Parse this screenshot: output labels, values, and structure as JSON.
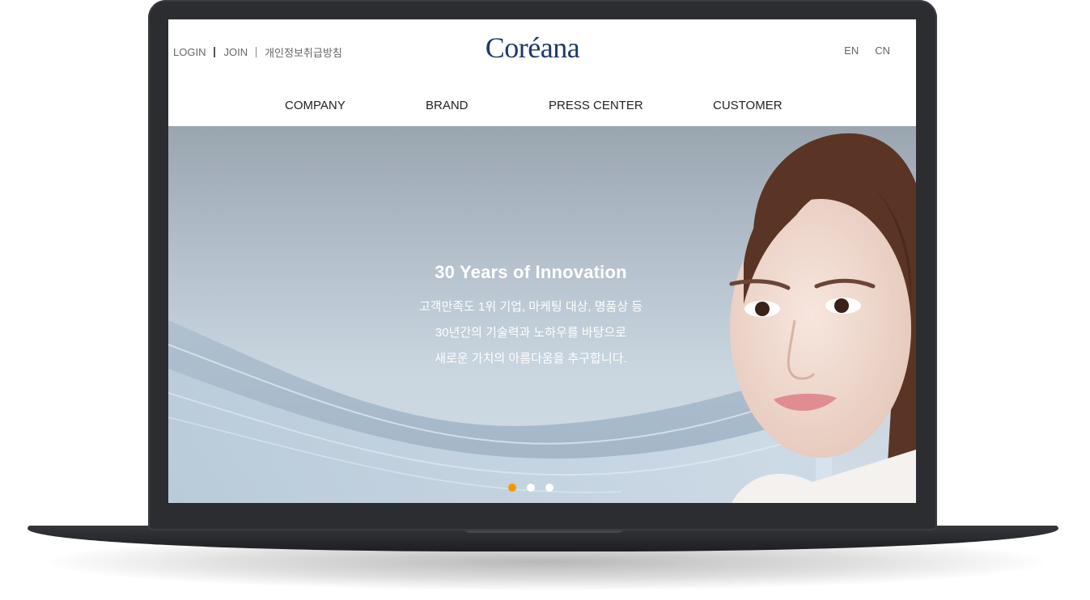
{
  "header": {
    "util": {
      "login": "LOGIN",
      "join": "JOIN",
      "privacy": "개인정보취급방침"
    },
    "logo": "Coréana",
    "lang": [
      "EN",
      "CN"
    ]
  },
  "gnb": [
    "COMPANY",
    "BRAND",
    "PRESS CENTER",
    "CUSTOMER"
  ],
  "hero": {
    "title": "30 Years of Innovation",
    "lines": [
      "고객만족도 1위 기업, 마케팅 대상, 명품상 등",
      "30년간의 기술력과 노하우를 바탕으로",
      "새로운 가치의 아름다움을 추구합니다."
    ],
    "slides": 3,
    "active_slide": 1
  },
  "colors": {
    "logo": "#1d3a6c",
    "accent": "#f39800",
    "frame": "#2b2d31"
  }
}
